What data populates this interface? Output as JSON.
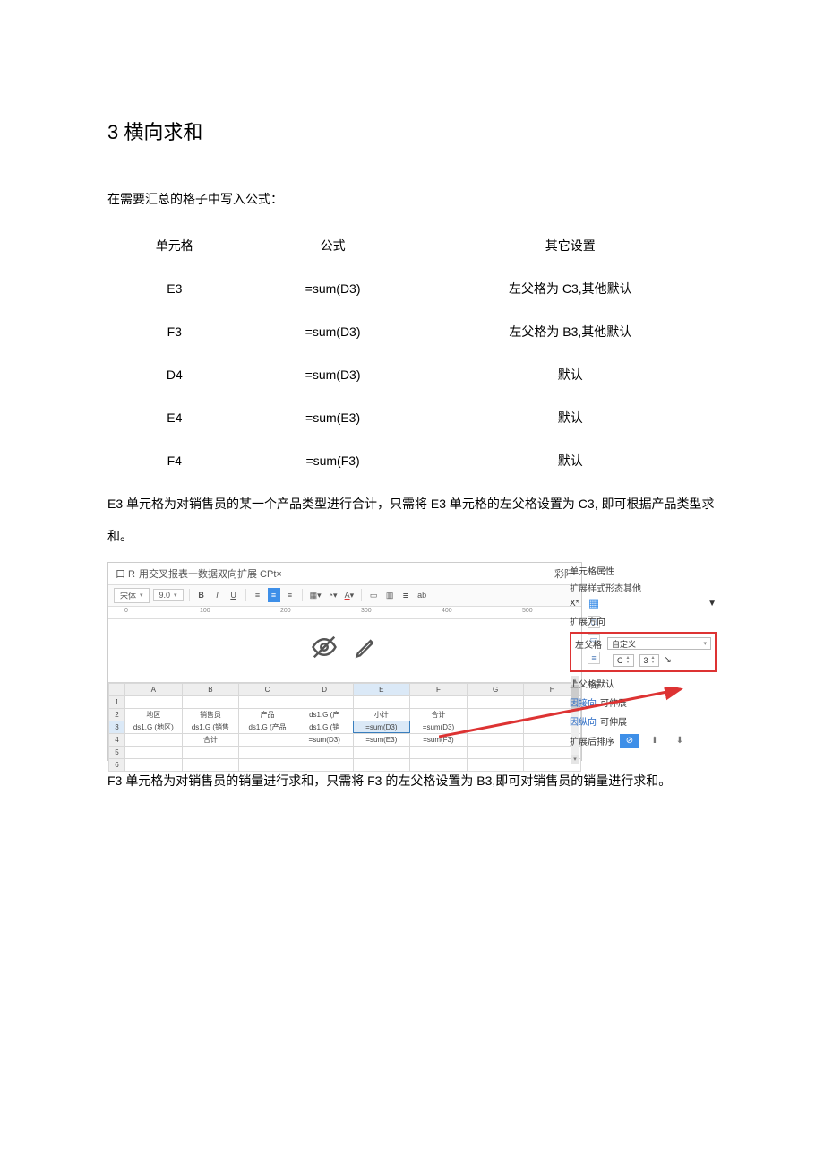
{
  "heading": "3 横向求和",
  "intro": "在需要汇总的格子中写入公式：",
  "table": {
    "headers": [
      "单元格",
      "公式",
      "其它设置"
    ],
    "rows": [
      {
        "cell": "E3",
        "formula": "=sum(D3)",
        "setting": "左父格为 C3,其他默认"
      },
      {
        "cell": "F3",
        "formula": "=sum(D3)",
        "setting": "左父格为 B3,其他默认"
      },
      {
        "cell": "D4",
        "formula": "=sum(D3)",
        "setting": "默认"
      },
      {
        "cell": "E4",
        "formula": "=sum(E3)",
        "setting": "默认"
      },
      {
        "cell": "F4",
        "formula": "=sum(F3)",
        "setting": "默认"
      }
    ]
  },
  "para_middle": "E3 单元格为对销售员的某一个产品类型进行合计，只需将 E3 单元格的左父格设置为 C3, 即可根据产品类型求和。",
  "para_after": "F3 单元格为对销售员的销量进行求和，只需将 F3 的左父格设置为 B3,即可对销售员的销量进行求和。",
  "shot": {
    "title_prefix": "口 R",
    "title_main": "用交叉报表一数据双向扩展 CPt×",
    "title_right": "彩阡",
    "toolbar": {
      "font_name": "宋体",
      "font_size": "9.0"
    },
    "ruler": [
      "0",
      "100",
      "200",
      "300",
      "400",
      "500"
    ],
    "grid": {
      "cols": [
        "A",
        "B",
        "C",
        "D",
        "E",
        "F",
        "G",
        "H"
      ],
      "rows": [
        {
          "n": "1",
          "cells": [
            "",
            "",
            "",
            "",
            "",
            "",
            "",
            ""
          ]
        },
        {
          "n": "2",
          "cells": [
            "地区",
            "销售员",
            "产品",
            "ds1.G (产",
            "小计",
            "合计",
            "",
            ""
          ]
        },
        {
          "n": "3",
          "cells": [
            "ds1.G (地区)",
            "ds1.G (销售",
            "ds1.G (产品",
            "ds1.G (销",
            "=sum(D3)",
            "=sum(D3)",
            "",
            ""
          ]
        },
        {
          "n": "4",
          "cells": [
            "",
            "合计",
            "",
            "=sum(D3)",
            "=sum(E3)",
            "=sum(F3)",
            "",
            ""
          ]
        },
        {
          "n": "5",
          "cells": [
            "",
            "",
            "",
            "",
            "",
            "",
            "",
            ""
          ]
        },
        {
          "n": "6",
          "cells": [
            "",
            "",
            "",
            "",
            "",
            "",
            "",
            ""
          ]
        }
      ]
    },
    "props": {
      "panel_title": "单元格属性",
      "tabs": "扩展样式形态其他",
      "x_label": "X*",
      "expand_dir": "扩展方向",
      "left_parent_label": "左父格",
      "left_parent_mode": "自定义",
      "left_parent_col": "C",
      "left_parent_row": "3",
      "top_parent": "上父格默认",
      "extend_h_label_pre": "因接向",
      "extend_h_label_suf": "可伸展",
      "extend_v_label_pre": "因纵向",
      "extend_v_label_suf": "可伸展",
      "sort_label": "扩展后排序"
    }
  }
}
